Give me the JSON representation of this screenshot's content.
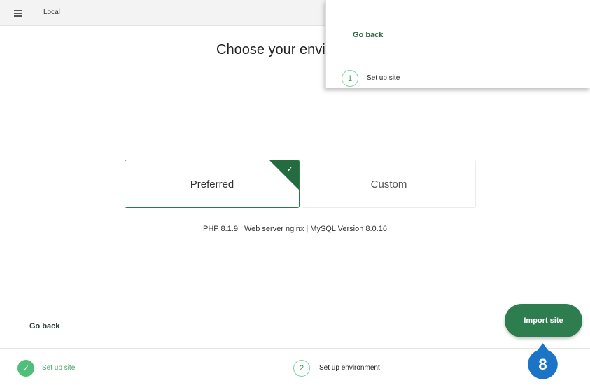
{
  "window": {
    "app_title": "Local"
  },
  "main": {
    "title": "Choose your environment",
    "options": [
      {
        "label": "Preferred",
        "selected": true
      },
      {
        "label": "Custom",
        "selected": false
      }
    ],
    "env_details": "PHP 8.1.9 | Web server nginx | MySQL Version 8.0.16",
    "go_back": "Go back",
    "import_button": "Import site"
  },
  "footer": {
    "steps": [
      {
        "number": "1",
        "label": "Set up site",
        "status": "complete",
        "icon": "check-icon"
      },
      {
        "number": "2",
        "label": "Set up environment",
        "status": "current"
      }
    ]
  },
  "callout": {
    "number": "8",
    "color": "#1c74c7"
  },
  "zoom_inset": {
    "go_back": "Go back",
    "step": {
      "number": "1",
      "label": "Set up site"
    }
  },
  "colors": {
    "accent": "#2e7d4f",
    "accent_dark": "#246b40",
    "step_complete": "#4fbf7a",
    "callout": "#1c74c7"
  }
}
